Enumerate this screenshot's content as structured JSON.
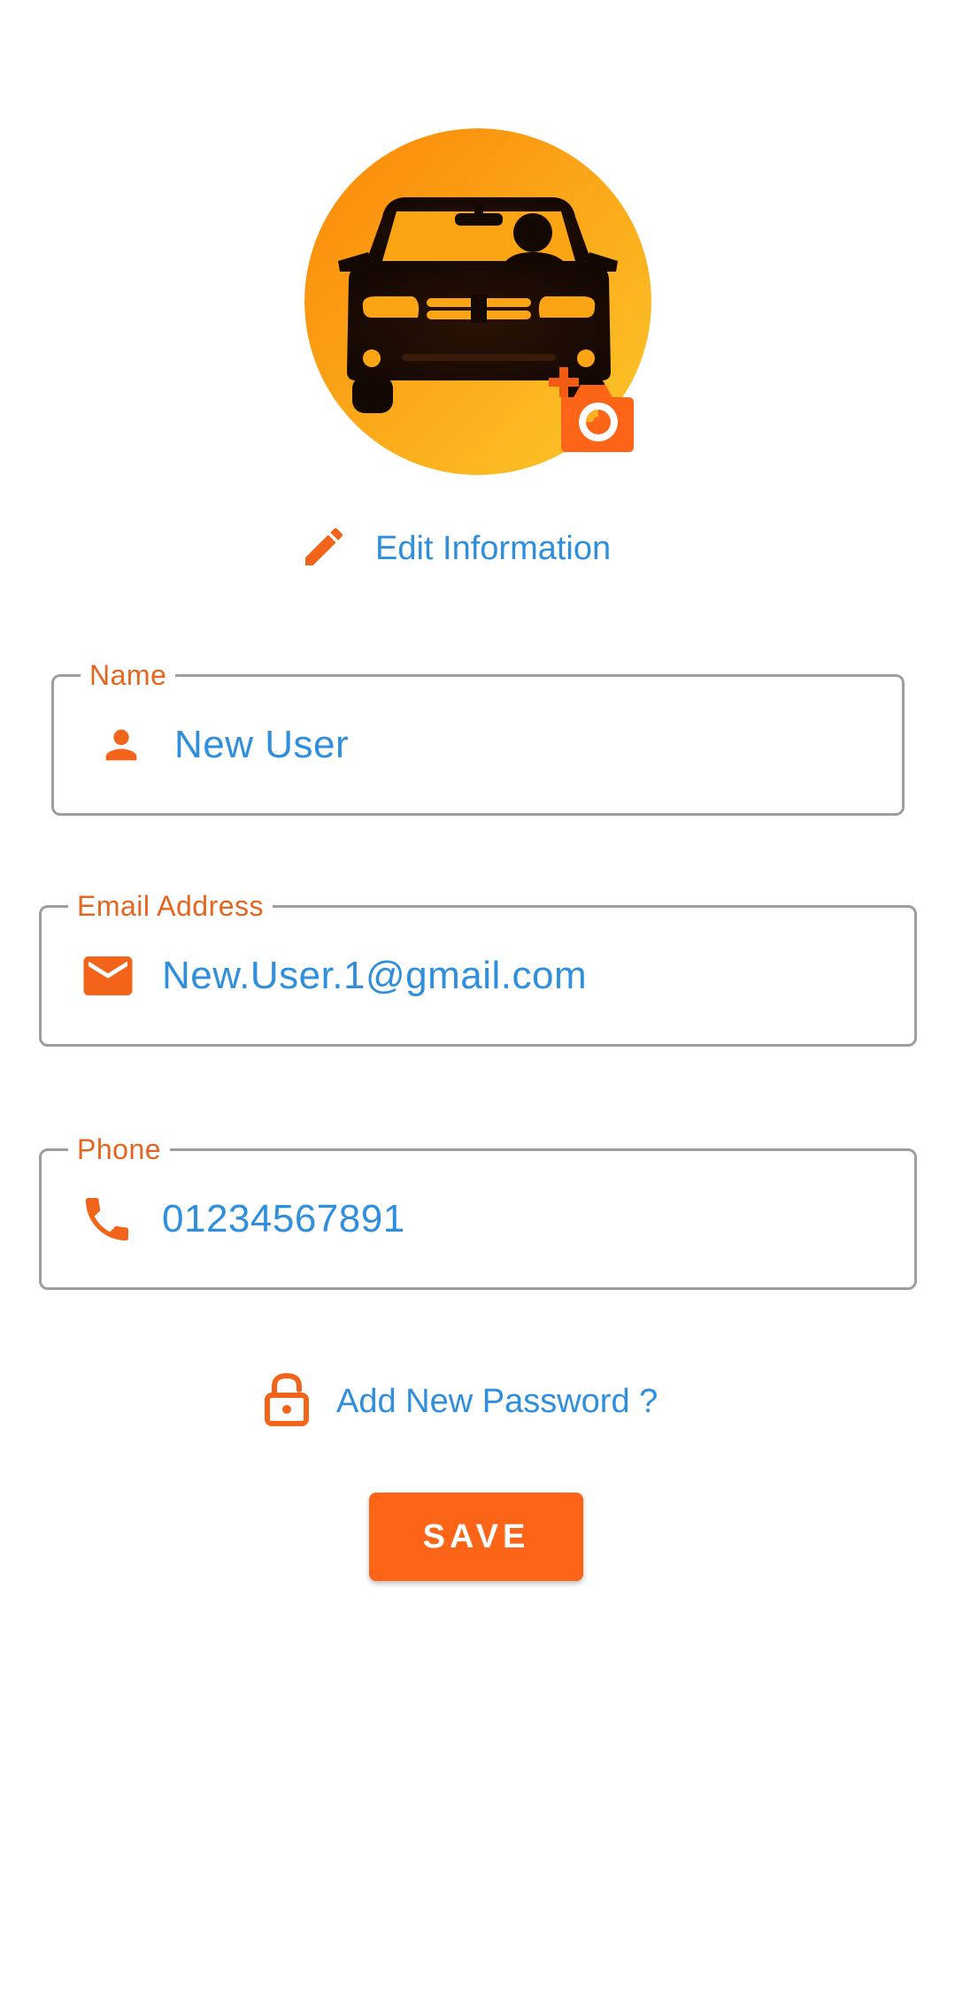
{
  "profile": {
    "avatar_icon": "car-driver-icon",
    "camera_icon": "add-photo-camera-icon",
    "edit_label": "Edit Information",
    "edit_icon": "pencil-icon"
  },
  "form": {
    "name": {
      "label": "Name",
      "value": "New User",
      "icon": "person-icon"
    },
    "email": {
      "label": "Email Address",
      "value": "New.User.1@gmail.com",
      "icon": "mail-icon"
    },
    "phone": {
      "label": "Phone",
      "value": "01234567891",
      "icon": "phone-icon"
    }
  },
  "password": {
    "label": "Add New Password ?",
    "icon": "lock-open-icon"
  },
  "save_label": "SAVE",
  "colors": {
    "accent": "#fc6517",
    "text_blue": "#2f8fdc",
    "label_orange": "#e5641e",
    "avatar_gradient_start": "#fb8c0c",
    "avatar_gradient_end": "#fbc423"
  }
}
